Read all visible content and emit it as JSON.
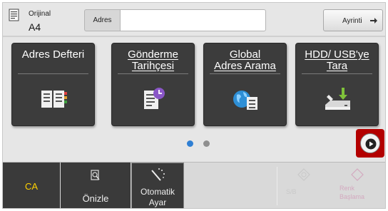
{
  "header": {
    "original_label": "Orijinal",
    "original_value": "A4",
    "address_label": "Adres",
    "address_value": "",
    "detail_label": "Ayrinti"
  },
  "tiles": [
    {
      "title": "Adres Defteri",
      "icon": "address-book-icon"
    },
    {
      "title": "Gönderme\nTarihçesi",
      "icon": "send-history-icon"
    },
    {
      "title": "Global\nAdres Arama",
      "icon": "global-address-search-icon"
    },
    {
      "title": "HDD/ USB'ye\nTara",
      "icon": "scan-to-hdd-usb-icon"
    }
  ],
  "pagination": {
    "current": 1,
    "total": 2
  },
  "bottom": {
    "ca_label": "CA",
    "preview_label": "Önizle",
    "auto_label": "Otomatik\nAyar",
    "bw_label": "S/B",
    "color_label": "Renk\nBaşlama"
  },
  "colors": {
    "tile": "#3c3c3c",
    "dot_active": "#2f7fd3",
    "dot_inactive": "#8f8f8f",
    "next_highlight": "#b30000",
    "ca_text": "#ffd200"
  }
}
